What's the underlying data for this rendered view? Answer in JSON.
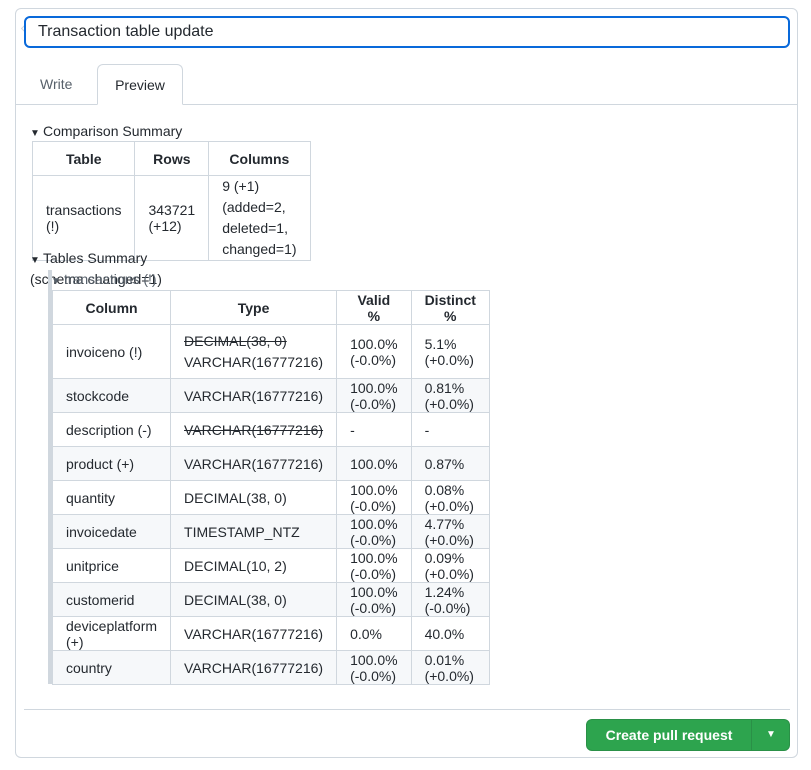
{
  "title_input": {
    "value": "Transaction table update"
  },
  "tabs": {
    "write": "Write",
    "preview": "Preview"
  },
  "comparison": {
    "heading": "Comparison Summary",
    "headers": [
      "Table",
      "Rows",
      "Columns"
    ],
    "row": {
      "table": "transactions (!)",
      "rows": "343721 (+12)",
      "columns_line1": "9 (+1)",
      "columns_line2": "(added=2, deleted=1, changed=1)"
    }
  },
  "tables_summary": {
    "heading": "Tables Summary (schema changed=1)",
    "table_heading": "transactions (!)",
    "headers": [
      "Column",
      "Type",
      "Valid %",
      "Distinct %"
    ],
    "rows": [
      {
        "column": "invoiceno (!)",
        "type_old": "DECIMAL(38, 0)",
        "type": "VARCHAR(16777216)",
        "valid": "100.0% (-0.0%)",
        "distinct": "5.1% (+0.0%)"
      },
      {
        "column": "stockcode",
        "type": "VARCHAR(16777216)",
        "valid": "100.0% (-0.0%)",
        "distinct": "0.81% (+0.0%)"
      },
      {
        "column": "description (-)",
        "type_old": "VARCHAR(16777216)",
        "valid": "-",
        "distinct": "-"
      },
      {
        "column": "product (+)",
        "type": "VARCHAR(16777216)",
        "valid": "100.0%",
        "distinct": "0.87%"
      },
      {
        "column": "quantity",
        "type": "DECIMAL(38, 0)",
        "valid": "100.0% (-0.0%)",
        "distinct": "0.08% (+0.0%)"
      },
      {
        "column": "invoicedate",
        "type": "TIMESTAMP_NTZ",
        "valid": "100.0% (-0.0%)",
        "distinct": "4.77% (+0.0%)"
      },
      {
        "column": "unitprice",
        "type": "DECIMAL(10, 2)",
        "valid": "100.0% (-0.0%)",
        "distinct": "0.09% (+0.0%)"
      },
      {
        "column": "customerid",
        "type": "DECIMAL(38, 0)",
        "valid": "100.0% (-0.0%)",
        "distinct": "1.24% (-0.0%)"
      },
      {
        "column": "deviceplatform (+)",
        "type": "VARCHAR(16777216)",
        "valid": "0.0%",
        "distinct": "40.0%"
      },
      {
        "column": "country",
        "type": "VARCHAR(16777216)",
        "valid": "100.0% (-0.0%)",
        "distinct": "0.01% (+0.0%)"
      }
    ]
  },
  "actions": {
    "create_pr": "Create pull request",
    "dropdown_icon": "triangle-down-icon"
  },
  "colors": {
    "primary_button": "#2da44e",
    "focus_border": "#0969da",
    "border": "#d0d7de"
  }
}
